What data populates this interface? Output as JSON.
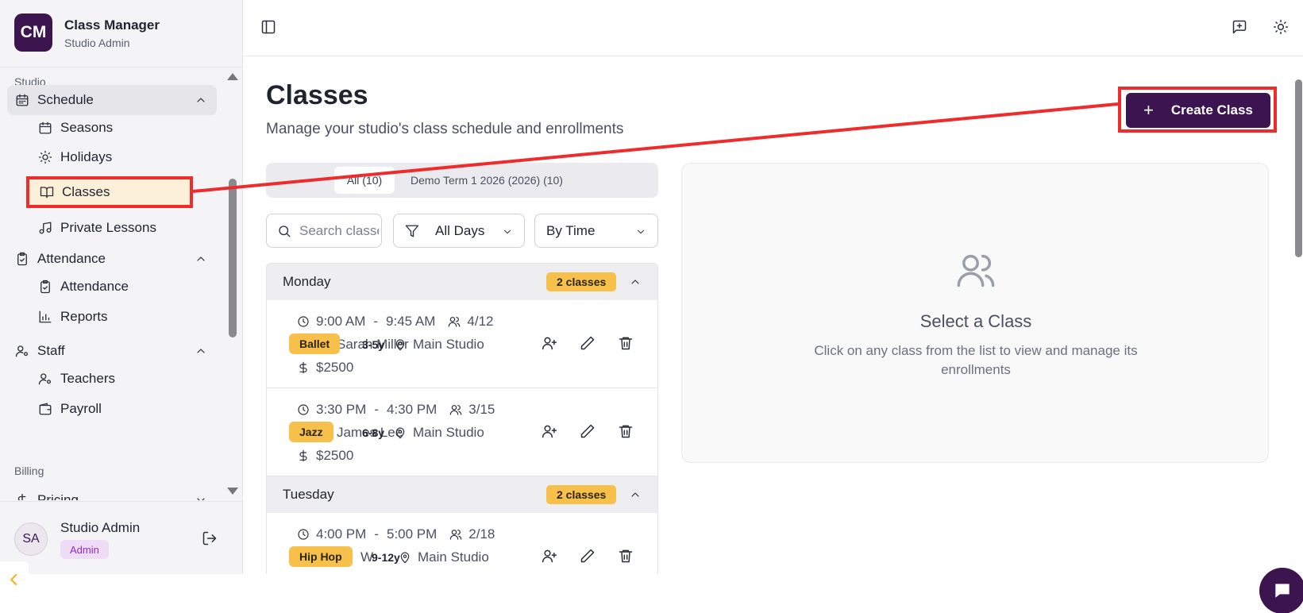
{
  "brand": {
    "logo": "CM",
    "name": "Class Manager",
    "subtitle": "Studio Admin"
  },
  "sidebar": {
    "sections": {
      "studio": "Studio",
      "billing": "Billing"
    },
    "schedule": {
      "label": "Schedule",
      "icon": "calendar-icon",
      "items": [
        {
          "label": "Seasons",
          "icon": "calendar-icon"
        },
        {
          "label": "Holidays",
          "icon": "sun-icon"
        },
        {
          "label": "Classes",
          "icon": "book-open-icon"
        },
        {
          "label": "Private Lessons",
          "icon": "music-icon"
        }
      ]
    },
    "attendance": {
      "label": "Attendance",
      "icon": "clipboard-check-icon",
      "items": [
        {
          "label": "Attendance",
          "icon": "clipboard-check-icon"
        },
        {
          "label": "Reports",
          "icon": "bar-chart-icon"
        }
      ]
    },
    "staff": {
      "label": "Staff",
      "icon": "user-cog-icon",
      "items": [
        {
          "label": "Teachers",
          "icon": "user-cog-icon"
        },
        {
          "label": "Payroll",
          "icon": "wallet-icon"
        }
      ]
    },
    "pricing": {
      "label": "Pricing",
      "icon": "dollar-icon"
    },
    "active_item": "Classes"
  },
  "user": {
    "initials": "SA",
    "name": "Studio Admin",
    "role": "Admin"
  },
  "page": {
    "title": "Classes",
    "subtitle": "Manage your studio's class schedule and enrollments",
    "create_button": "Create Class"
  },
  "tabs": [
    {
      "label": "All (10)",
      "selected": true
    },
    {
      "label": "Demo Term 1 2026 (2026) (10)",
      "selected": false
    }
  ],
  "filters": {
    "search_placeholder": "Search classes...",
    "day_filter": "All Days",
    "sort": "By Time"
  },
  "days": [
    {
      "name": "Monday",
      "count": "2 classes",
      "classes": [
        {
          "start": "9:00 AM",
          "end": "9:45 AM",
          "enrollment": "4/12",
          "style": "Ballet",
          "name": "Sarah Miller",
          "age": "3-5y",
          "location": "Main Studio",
          "price": "$2500"
        },
        {
          "start": "3:30 PM",
          "end": "4:30 PM",
          "enrollment": "3/15",
          "style": "Jazz",
          "name": "James Lee",
          "age": "6-8y",
          "location": "Main Studio",
          "price": "$2500"
        }
      ]
    },
    {
      "name": "Tuesday",
      "count": "2 classes",
      "classes": [
        {
          "start": "4:00 PM",
          "end": "5:00 PM",
          "enrollment": "2/18",
          "style": "Hip Hop",
          "name": "W",
          "age": "9-12y",
          "location": "Main Studio",
          "price": ""
        }
      ]
    }
  ],
  "detail": {
    "title": "Select a Class",
    "text": "Click on any class from the list to view and manage its enrollments"
  },
  "colors": {
    "brand": "#3b1450",
    "accent_badge": "#f7c04a",
    "highlight": "#ee2c2c"
  }
}
